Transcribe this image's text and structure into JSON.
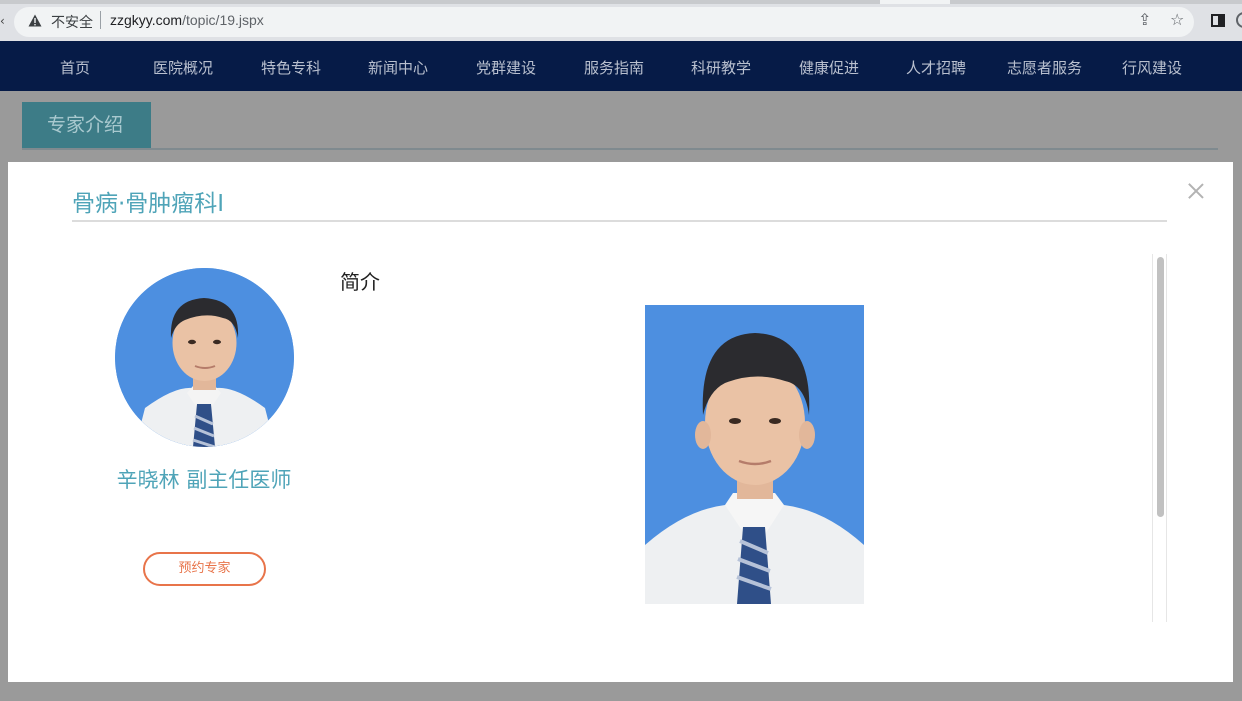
{
  "browser": {
    "insecure_label": "不安全",
    "url_host": "zzgkyy.com",
    "url_path": "/topic/19.jspx"
  },
  "nav": {
    "items": [
      "首页",
      "医院概况",
      "特色专科",
      "新闻中心",
      "党群建设",
      "服务指南",
      "科研教学",
      "健康促进",
      "人才招聘",
      "志愿者服务",
      "行风建设"
    ]
  },
  "section": {
    "title": "专家介绍"
  },
  "modal": {
    "title": "骨病·骨肿瘤科Ⅰ",
    "doctor_name": "辛晓林 副主任医师",
    "book_label": "预约专家",
    "intro_heading": "简介"
  },
  "colors": {
    "accent": "#4fa4b8",
    "nav_bg": "#0a2a6d",
    "book_button": "#e8744a",
    "photo_bg": "#4d8fe0"
  },
  "icons": {
    "warning": "warning-triangle-icon",
    "share": "share-icon",
    "bookmark": "star-icon",
    "sidepanel": "side-panel-icon",
    "close": "close-icon"
  }
}
